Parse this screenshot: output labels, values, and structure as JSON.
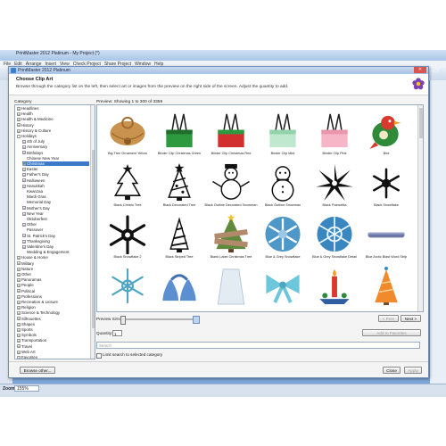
{
  "background_app": {
    "title": "PrintMaster 2012 Platinum - My Project (*)",
    "menu": [
      "File",
      "Edit",
      "Arrange",
      "Insert",
      "View",
      "Check Project",
      "Share Project",
      "Window",
      "Help"
    ],
    "logo": "PrintMaster",
    "zoom_label": "Zoom:",
    "zoom_value": "155%"
  },
  "dialog": {
    "title": "PrintMaster 2012 Platinum",
    "heading": "Choose Clip Art",
    "description": "Browse through the category list on the left, then select art or images from the preview on the right side of the screen. Adjust the quantity to add.",
    "category_label": "Category",
    "categories": [
      {
        "label": "Headlines",
        "level": 0,
        "expand": "+"
      },
      {
        "label": "Health",
        "level": 0,
        "expand": "+"
      },
      {
        "label": "Health & Medicine",
        "level": 0,
        "expand": "+"
      },
      {
        "label": "History",
        "level": 0,
        "expand": "+"
      },
      {
        "label": "History & Culture",
        "level": 0,
        "expand": "+"
      },
      {
        "label": "Holidays",
        "level": 0,
        "expand": "-"
      },
      {
        "label": "4th of July",
        "level": 1,
        "expand": "+"
      },
      {
        "label": "Anniversary",
        "level": 1,
        "expand": "+"
      },
      {
        "label": "Birthdays",
        "level": 1,
        "expand": "+"
      },
      {
        "label": "Chinese New Year",
        "level": 1,
        "expand": ""
      },
      {
        "label": "Christmas",
        "level": 1,
        "expand": "+",
        "selected": true
      },
      {
        "label": "Easter",
        "level": 1,
        "expand": "+"
      },
      {
        "label": "Father's Day",
        "level": 1,
        "expand": "+"
      },
      {
        "label": "Halloween",
        "level": 1,
        "expand": "+"
      },
      {
        "label": "Hanukkah",
        "level": 1,
        "expand": "+"
      },
      {
        "label": "Kwanzaa",
        "level": 1,
        "expand": ""
      },
      {
        "label": "Mardi Gras",
        "level": 1,
        "expand": ""
      },
      {
        "label": "Memorial Day",
        "level": 1,
        "expand": ""
      },
      {
        "label": "Mother's Day",
        "level": 1,
        "expand": "+"
      },
      {
        "label": "New Year",
        "level": 1,
        "expand": "+"
      },
      {
        "label": "Oktoberfest",
        "level": 1,
        "expand": ""
      },
      {
        "label": "Other",
        "level": 1,
        "expand": "+"
      },
      {
        "label": "Passover",
        "level": 1,
        "expand": ""
      },
      {
        "label": "St. Patrick's Day",
        "level": 1,
        "expand": "+"
      },
      {
        "label": "Thanksgiving",
        "level": 1,
        "expand": "+"
      },
      {
        "label": "Valentine's Day",
        "level": 1,
        "expand": "+"
      },
      {
        "label": "Wedding & Engagement",
        "level": 1,
        "expand": ""
      },
      {
        "label": "House & Home",
        "level": 0,
        "expand": "+"
      },
      {
        "label": "Military",
        "level": 0,
        "expand": "+"
      },
      {
        "label": "Nature",
        "level": 0,
        "expand": "+"
      },
      {
        "label": "Other",
        "level": 0,
        "expand": "+"
      },
      {
        "label": "Panoramas",
        "level": 0,
        "expand": "+"
      },
      {
        "label": "People",
        "level": 0,
        "expand": "+"
      },
      {
        "label": "Political",
        "level": 0,
        "expand": "+"
      },
      {
        "label": "Professions",
        "level": 0,
        "expand": "+"
      },
      {
        "label": "Recreation & Leisure",
        "level": 0,
        "expand": "+"
      },
      {
        "label": "Religion",
        "level": 0,
        "expand": "+"
      },
      {
        "label": "Science & Technology",
        "level": 0,
        "expand": "+"
      },
      {
        "label": "Silhouettes",
        "level": 0,
        "expand": "+"
      },
      {
        "label": "Shapes",
        "level": 0,
        "expand": "+"
      },
      {
        "label": "Sports",
        "level": 0,
        "expand": "+"
      },
      {
        "label": "Symbols",
        "level": 0,
        "expand": "+"
      },
      {
        "label": "Transportation",
        "level": 0,
        "expand": "+"
      },
      {
        "label": "Travel",
        "level": 0,
        "expand": "+"
      },
      {
        "label": "Web Art",
        "level": 0,
        "expand": "+"
      },
      {
        "label": "Favorites",
        "level": 0,
        "expand": "+"
      }
    ],
    "preview_label": "Preview: Showing 1 to 300 of 3359",
    "preview_items": [
      {
        "caption": "Big Tree Ornament Yellow",
        "icon": "bell-ornament-icon"
      },
      {
        "caption": "Binder Clip Christmas Green",
        "icon": "binder-clip-green-icon"
      },
      {
        "caption": "Binder Clip Christmas Red",
        "icon": "binder-clip-red-icon"
      },
      {
        "caption": "Binder Clip Mint",
        "icon": "binder-clip-mint-icon"
      },
      {
        "caption": "Binder Clip Pink",
        "icon": "binder-clip-pink-icon"
      },
      {
        "caption": "Bird",
        "icon": "bird-icon"
      },
      {
        "caption": "Black Christo Tree",
        "icon": "christmas-tree-icon"
      },
      {
        "caption": "Black Decorated Tree",
        "icon": "decorated-tree-icon"
      },
      {
        "caption": "Black Outline Decorated Snowman",
        "icon": "snowman-outline-icon"
      },
      {
        "caption": "Black Outline Snowman",
        "icon": "snowman-icon"
      },
      {
        "caption": "Black Poinsettia",
        "icon": "poinsettia-icon"
      },
      {
        "caption": "Black Snowflake",
        "icon": "snowflake-icon"
      },
      {
        "caption": "Black Snowflake 2",
        "icon": "snowflake-2-icon"
      },
      {
        "caption": "Black Striped Tree",
        "icon": "striped-tree-icon"
      },
      {
        "caption": "Blank Label Christmas Tree",
        "icon": "label-tree-icon"
      },
      {
        "caption": "Blue & Grey Snowflake",
        "icon": "blue-snowflake-icon"
      },
      {
        "caption": "Blue & Grey Snowflake Detail",
        "icon": "blue-snowflake-detail-icon"
      },
      {
        "caption": "Blue Arctic Blast Word Strip",
        "icon": "word-strip-icon"
      },
      {
        "caption": "",
        "icon": "snowflake-teal-icon"
      },
      {
        "caption": "",
        "icon": "blue-bells-icon"
      },
      {
        "caption": "",
        "icon": "glass-vase-icon"
      },
      {
        "caption": "",
        "icon": "blue-bow-icon"
      },
      {
        "caption": "",
        "icon": "candle-decoration-icon"
      },
      {
        "caption": "",
        "icon": "orange-tree-icon"
      }
    ],
    "preview_size_label": "Preview Size:",
    "prev_button": "< Prev",
    "next_button": "Next >",
    "quantity_label": "Quantity:",
    "quantity_value": "1",
    "add_favorites_button": "Add to Favorites",
    "search_placeholder": "Search",
    "limit_search_label": "Limit search to selected category",
    "browse_button": "Browse other...",
    "close_button": "Close",
    "apply_button": "Apply",
    "accent_color": "#3d79c9"
  }
}
